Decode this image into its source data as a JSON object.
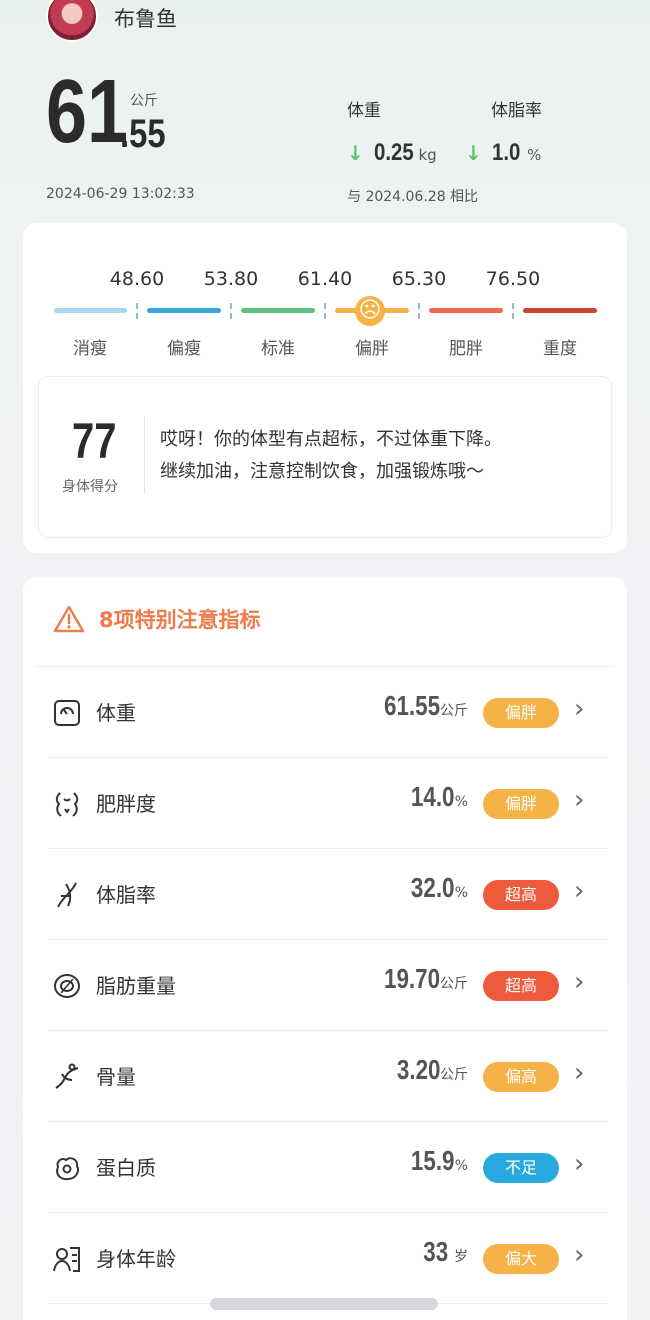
{
  "user": {
    "name": "布鲁鱼"
  },
  "weight": {
    "integer": "61",
    "decimal": ".55",
    "unit": "公斤"
  },
  "stats": [
    {
      "label": "体重",
      "arrow": "↓",
      "value": "0.25",
      "unit": "kg"
    },
    {
      "label": "体脂率",
      "arrow": "↓",
      "value": "1.0",
      "unit": "%"
    }
  ],
  "timestamp": "2024-06-29 13:02:33",
  "compare": "与 2024.06.28 相比",
  "scale": {
    "thresholds": [
      "48.60",
      "53.80",
      "61.40",
      "65.30",
      "76.50"
    ],
    "categories": [
      "消瘦",
      "偏瘦",
      "标准",
      "偏胖",
      "肥胖",
      "重度"
    ],
    "colors": [
      "#a9d6f2",
      "#3aa7da",
      "#5cc17c",
      "#f5b247",
      "#ef6a4d",
      "#c8452f"
    ],
    "face": "☹"
  },
  "score": {
    "value": "77",
    "label": "身体得分",
    "line1": "哎呀！你的体型有点超标，不过体重下降。",
    "line2": "继续加油，注意控制饮食，加强锻炼哦～"
  },
  "warning": {
    "title": "8项特别注意指标",
    "color": "#ef7a4a"
  },
  "indicators": [
    {
      "icon": "scale-icon",
      "name": "体重",
      "value": "61.55",
      "unit": "公斤",
      "badge": "偏胖",
      "badge_color": "#f5b247"
    },
    {
      "icon": "body-outline-icon",
      "name": "肥胖度",
      "value": "14.0",
      "unit": "%",
      "badge": "偏胖",
      "badge_color": "#f5b247"
    },
    {
      "icon": "dna-icon",
      "name": "体脂率",
      "value": "32.0",
      "unit": "%",
      "badge": "超高",
      "badge_color": "#ee5a3c"
    },
    {
      "icon": "fat-icon",
      "name": "脂肪重量",
      "value": "19.70",
      "unit": "公斤",
      "badge": "超高",
      "badge_color": "#ee5a3c"
    },
    {
      "icon": "bone-icon",
      "name": "骨量",
      "value": "3.20",
      "unit": "公斤",
      "badge": "偏高",
      "badge_color": "#f5b247"
    },
    {
      "icon": "egg-icon",
      "name": "蛋白质",
      "value": "15.9",
      "unit": "%",
      "badge": "不足",
      "badge_color": "#2aa8e0"
    },
    {
      "icon": "person-card-icon",
      "name": "身体年龄",
      "value": "33",
      "unit": "岁",
      "badge": "偏大",
      "badge_color": "#f5b247"
    }
  ]
}
